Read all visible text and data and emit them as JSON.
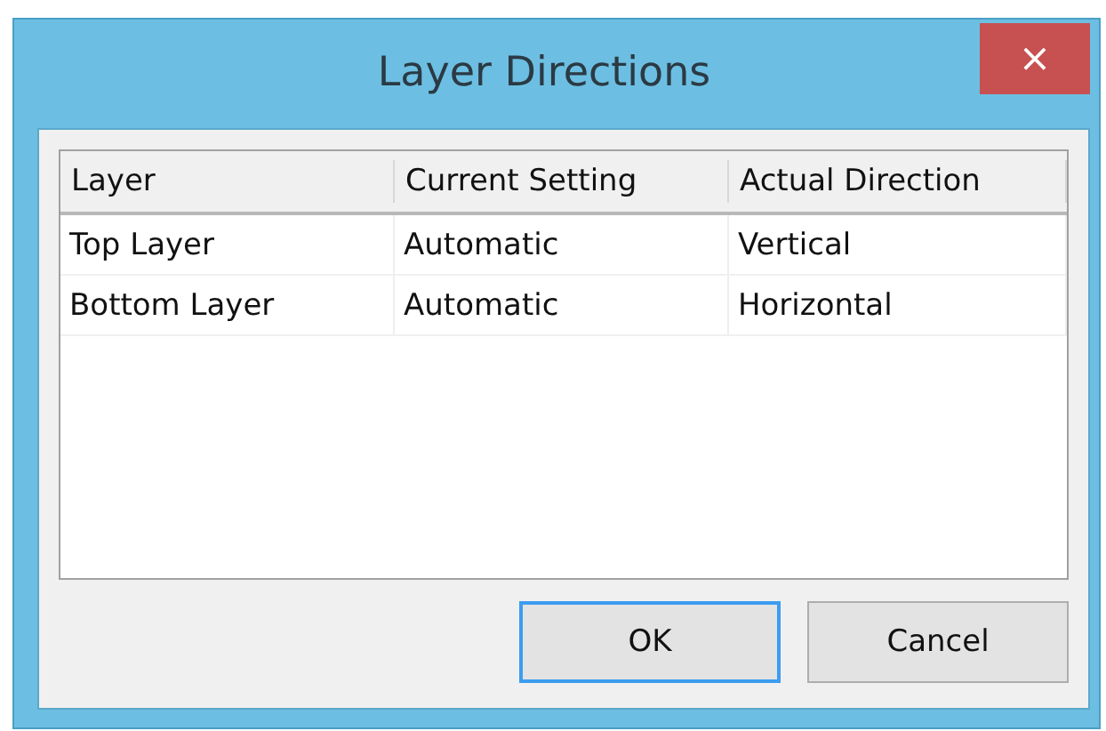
{
  "window": {
    "title": "Layer Directions",
    "close": "×"
  },
  "table": {
    "columns": [
      "Layer",
      "Current Setting",
      "Actual Direction"
    ],
    "rows": [
      [
        "Top Layer",
        "Automatic",
        "Vertical"
      ],
      [
        "Bottom Layer",
        "Automatic",
        "Horizontal"
      ]
    ]
  },
  "buttons": [
    {
      "label": "OK",
      "default": true
    },
    {
      "label": "Cancel",
      "default": false
    }
  ]
}
